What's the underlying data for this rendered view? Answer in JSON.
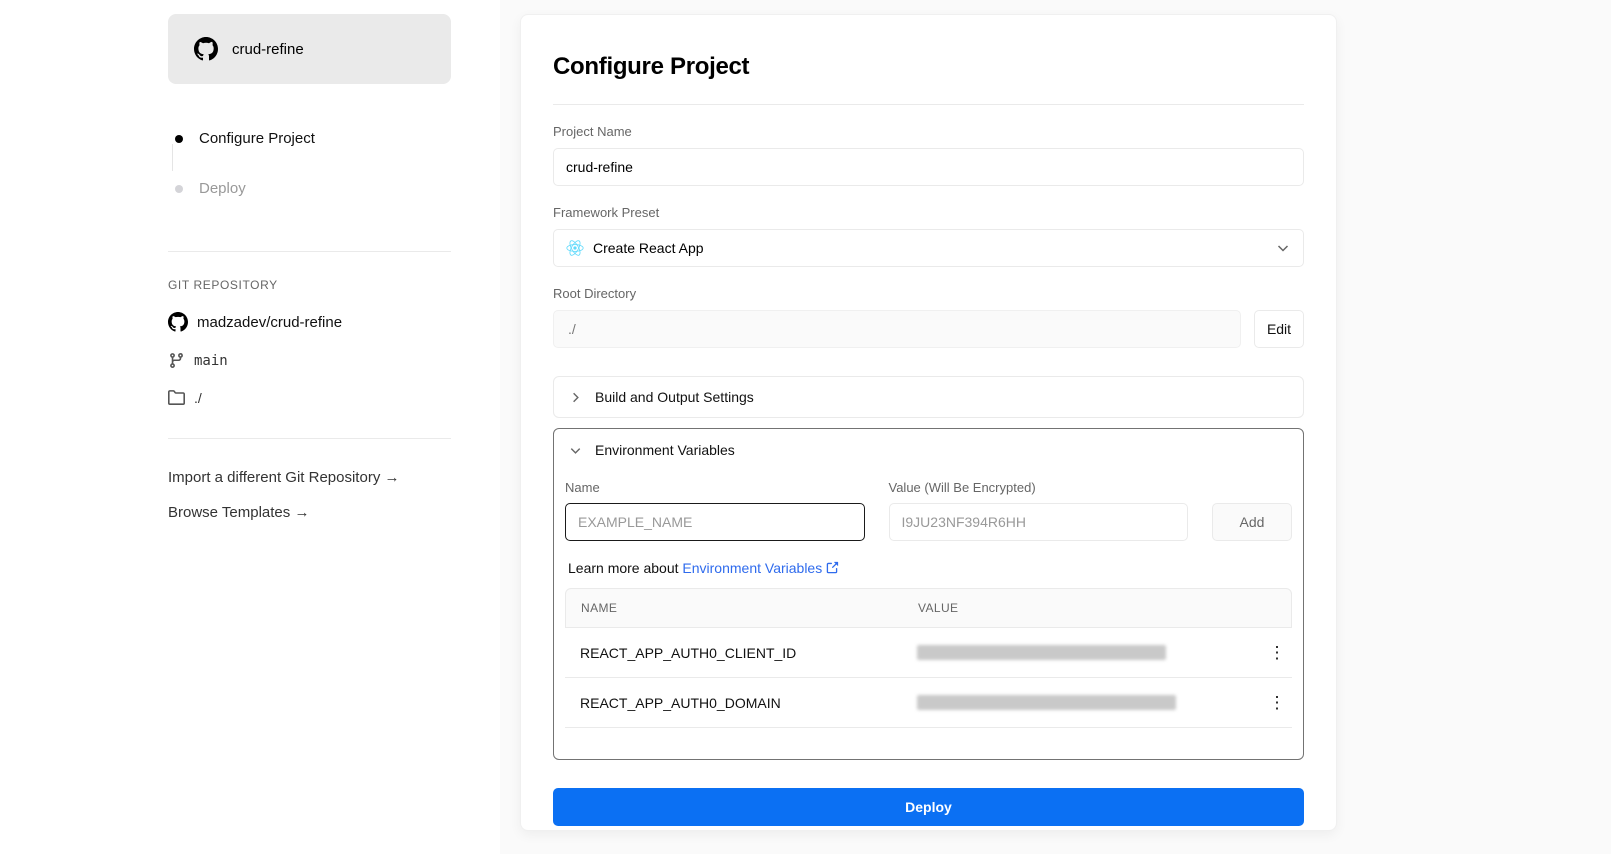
{
  "sidebar": {
    "repo_badge": {
      "name": "crud-refine"
    },
    "steps": [
      {
        "label": "Configure Project"
      },
      {
        "label": "Deploy"
      }
    ],
    "git_repository": {
      "heading": "GIT REPOSITORY",
      "repo": "madzadev/crud-refine",
      "branch": "main",
      "root": "./"
    },
    "links": [
      {
        "label": "Import a different Git Repository →"
      },
      {
        "label": "Browse Templates →"
      }
    ]
  },
  "main": {
    "title": "Configure Project",
    "project_name": {
      "label": "Project Name",
      "value": "crud-refine"
    },
    "framework_preset": {
      "label": "Framework Preset",
      "value": "Create React App"
    },
    "root_directory": {
      "label": "Root Directory",
      "value": "./",
      "edit_label": "Edit"
    },
    "build_settings": {
      "label": "Build and Output Settings"
    },
    "env": {
      "label": "Environment Variables",
      "name_label": "Name",
      "name_placeholder": "EXAMPLE_NAME",
      "value_label": "Value (Will Be Encrypted)",
      "value_placeholder": "I9JU23NF394R6HH",
      "add_label": "Add",
      "learn_more_prefix": "Learn more about ",
      "learn_more_link": "Environment Variables",
      "table": {
        "name_header": "NAME",
        "value_header": "VALUE",
        "rows": [
          {
            "name": "REACT_APP_AUTH0_CLIENT_ID",
            "value_hidden": true
          },
          {
            "name": "REACT_APP_AUTH0_DOMAIN",
            "value_hidden": true
          }
        ]
      }
    },
    "deploy_label": "Deploy"
  },
  "colors": {
    "accent_blue": "#0b70f3",
    "link_blue": "#2f6bed",
    "react_blue": "#61dafb",
    "env_box_border": "#737373"
  }
}
